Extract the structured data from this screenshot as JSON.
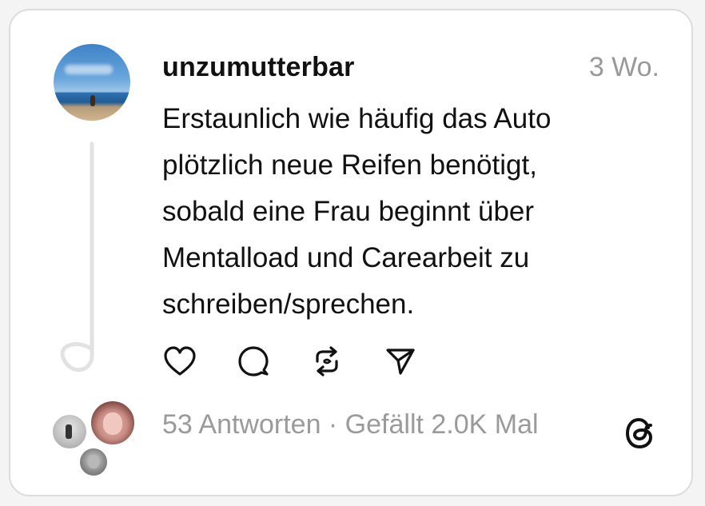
{
  "post": {
    "username": "unzumutterbar",
    "timestamp": "3 Wo.",
    "text_lines": [
      "Erstaunlich wie häufig das Auto",
      "plötzlich neue Reifen benötigt,",
      "sobald eine Frau beginnt über",
      "Mentalload und Carearbeit zu",
      "schreiben/sprechen."
    ]
  },
  "actions": {
    "like_icon": "heart-icon",
    "comment_icon": "comment-icon",
    "repost_icon": "repost-icon",
    "share_icon": "send-icon"
  },
  "footer": {
    "stats": "53 Antworten · Gefällt 2.0K Mal",
    "logo_icon": "threads-logo-icon"
  },
  "colors": {
    "text": "#111111",
    "muted": "#999999",
    "border": "#dcdcdc"
  }
}
